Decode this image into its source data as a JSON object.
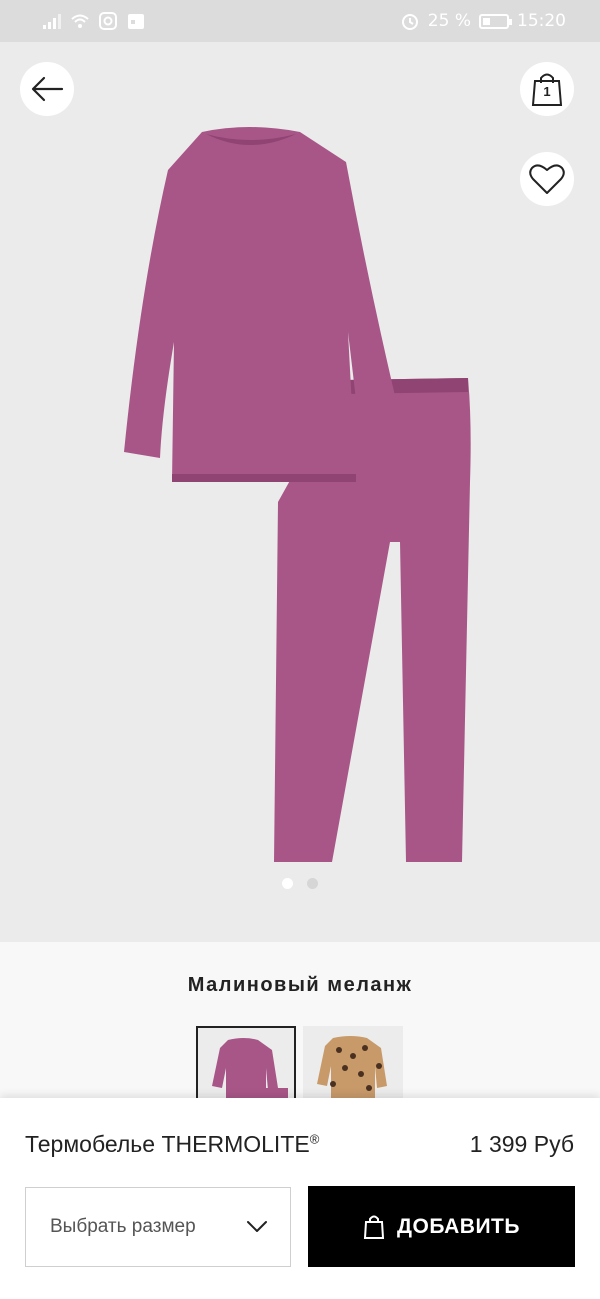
{
  "status_bar": {
    "battery_percent": "25 %",
    "time": "15:20"
  },
  "header": {
    "bag_count": "1"
  },
  "hero": {
    "image_count": 2,
    "active_index": 0,
    "colors": {
      "garment": "#a85688",
      "garment_shadow": "#8f4473",
      "background": "#ebebeb"
    }
  },
  "color_section": {
    "color_name": "Малиновый меланж",
    "swatches": [
      {
        "name": "pink",
        "selected": true
      },
      {
        "name": "leopard",
        "selected": false
      }
    ]
  },
  "product": {
    "title": "Термобелье THERMOLITE",
    "title_mark": "®",
    "price": "1 399 Руб"
  },
  "actions": {
    "size_select_label": "Выбрать размер",
    "add_label": "ДОБАВИТЬ"
  }
}
